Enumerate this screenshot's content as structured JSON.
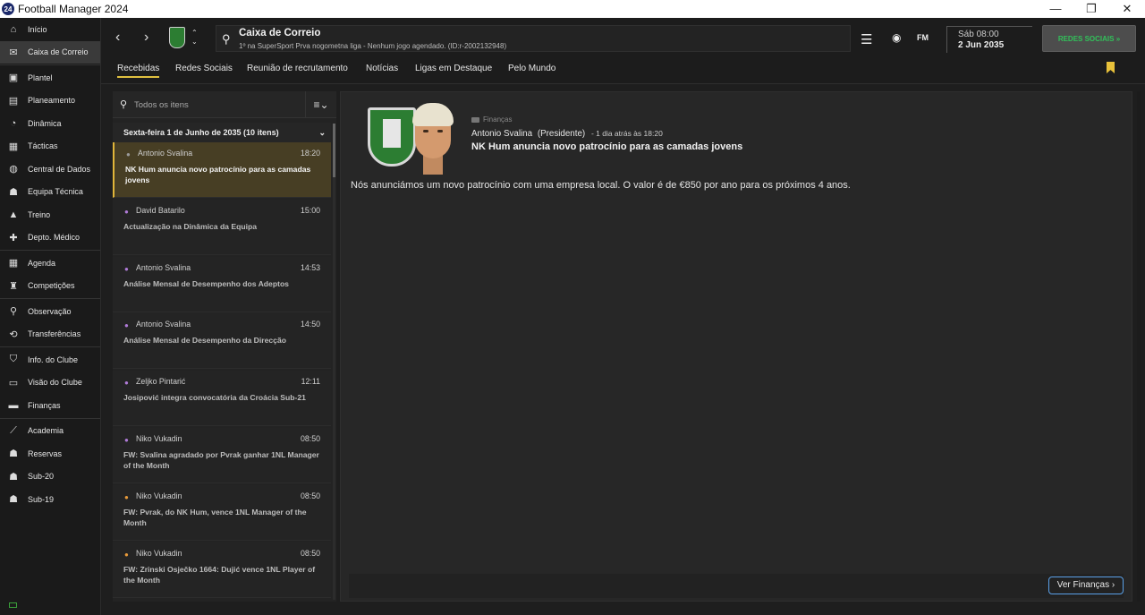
{
  "window": {
    "app_icon_text": "24",
    "title": "Football Manager 2024",
    "minimize": "—",
    "maximize": "❐",
    "close": "✕"
  },
  "sidebar": {
    "items": [
      {
        "label": "Início",
        "icon": "home-icon"
      },
      {
        "label": "Caixa de Correio",
        "icon": "inbox-icon",
        "active": true
      },
      {
        "label": "Plantel",
        "icon": "shirt-icon"
      },
      {
        "label": "Planeamento",
        "icon": "clipboard-icon"
      },
      {
        "label": "Dinâmica",
        "icon": "dynamics-icon"
      },
      {
        "label": "Tácticas",
        "icon": "tactics-icon"
      },
      {
        "label": "Central de Dados",
        "icon": "data-icon"
      },
      {
        "label": "Equipa Técnica",
        "icon": "staff-icon"
      },
      {
        "label": "Treino",
        "icon": "training-icon"
      },
      {
        "label": "Depto. Médico",
        "icon": "medical-icon"
      },
      {
        "label": "Agenda",
        "icon": "calendar-icon"
      },
      {
        "label": "Competições",
        "icon": "trophy-icon"
      },
      {
        "label": "Observação",
        "icon": "scout-icon"
      },
      {
        "label": "Transferências",
        "icon": "transfer-icon"
      },
      {
        "label": "Info. do Clube",
        "icon": "club-info-icon"
      },
      {
        "label": "Visão do Clube",
        "icon": "club-vision-icon"
      },
      {
        "label": "Finanças",
        "icon": "finance-icon"
      },
      {
        "label": "Academia",
        "icon": "academy-icon"
      },
      {
        "label": "Reservas",
        "icon": "reserves-icon"
      },
      {
        "label": "Sub-20",
        "icon": "u20-icon"
      },
      {
        "label": "Sub-19",
        "icon": "u19-icon"
      }
    ]
  },
  "topbar": {
    "back": "‹",
    "forward": "›",
    "title": "Caixa de Correio",
    "subtitle": "1º na SuperSport Prva nogometna liga - Nenhum jogo agendado. (ID:r-2002132948)",
    "fm_label": "FM",
    "date_day": "Sáb 08:00",
    "date_full": "2 Jun 2035",
    "social_button": "REDES SOCIAIS »"
  },
  "tabs": [
    "Recebidas",
    "Redes Sociais",
    "Reunião de recrutamento",
    "Notícias",
    "Ligas em Destaque",
    "Pelo Mundo"
  ],
  "inbox": {
    "search_placeholder": "Todos os itens",
    "group_header": "Sexta-feira 1 de Junho de 2035 (10 itens)",
    "messages": [
      {
        "sender": "Antonio Svalina",
        "time": "18:20",
        "subject": "NK Hum anuncia novo patrocínio para as camadas jovens",
        "avatar_color": "#9a9a9a"
      },
      {
        "sender": "David Batarilo",
        "time": "15:00",
        "subject": "Actualização na Dinâmica da Equipa",
        "avatar_color": "#b07bd8"
      },
      {
        "sender": "Antonio Svalina",
        "time": "14:53",
        "subject": "Análise Mensal de Desempenho dos Adeptos",
        "avatar_color": "#b07bd8"
      },
      {
        "sender": "Antonio Svalina",
        "time": "14:50",
        "subject": "Análise Mensal de Desempenho da Direcção",
        "avatar_color": "#b07bd8"
      },
      {
        "sender": "Zeljko Pintarić",
        "time": "12:11",
        "subject": "Josipović integra convocatória da Croácia Sub-21",
        "avatar_color": "#b07bd8"
      },
      {
        "sender": "Niko Vukadin",
        "time": "08:50",
        "subject": "FW: Svalina agradado por Pvrak ganhar 1NL Manager of the Month",
        "avatar_color": "#b07bd8"
      },
      {
        "sender": "Niko Vukadin",
        "time": "08:50",
        "subject": "FW: Pvrak, do NK Hum, vence 1NL Manager of the Month",
        "avatar_color": "#e89a3a"
      },
      {
        "sender": "Niko Vukadin",
        "time": "08:50",
        "subject": "FW: Zrinski Osječko 1664: Dujić vence 1NL Player of the Month",
        "avatar_color": "#e89a3a"
      }
    ]
  },
  "detail": {
    "category": "Finanças",
    "sender": "Antonio Svalina",
    "role": "(Presidente)",
    "ago": "- 1 dia atrás às 18:20",
    "headline": "NK Hum anuncia novo patrocínio para as camadas jovens",
    "body": "Nós anunciámos um novo patrocínio com uma empresa local. O valor é de €850 por ano para os próximos 4 anos.",
    "action_button": "Ver Finanças ›"
  }
}
